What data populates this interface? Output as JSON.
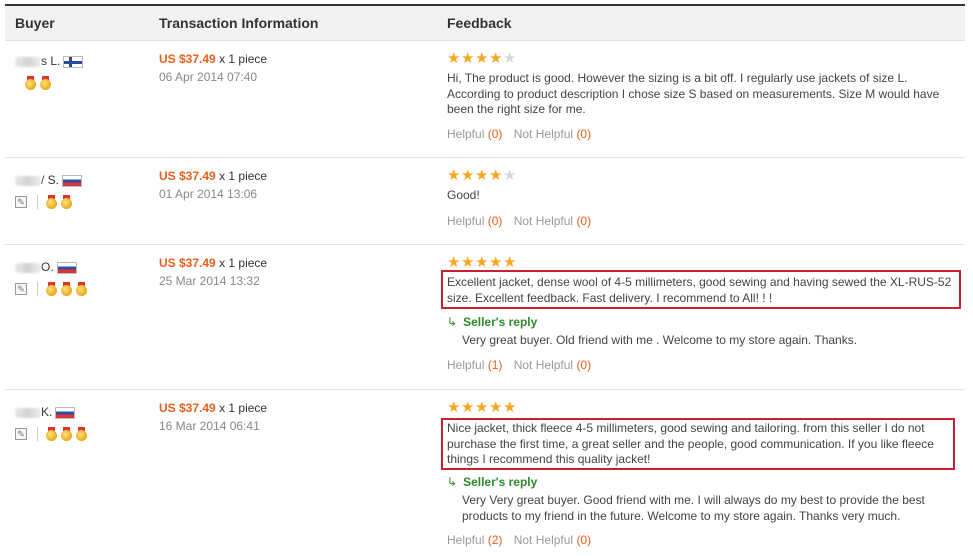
{
  "columns": {
    "buyer": "Buyer",
    "transaction": "Transaction Information",
    "feedback": "Feedback"
  },
  "reviews": [
    {
      "buyer_suffix": "s L.",
      "flag": "finland",
      "price": "US $37.49",
      "qty": "x 1 piece",
      "date": "06 Apr 2014 07:40",
      "rating": 4,
      "text": "Hi, The product is good. However the sizing is a bit off. I regularly use jackets of size L. According to product description I chose size S based on measurements. Size M would have been the right size for me.",
      "helpful_label": "Helpful",
      "helpful_count": "(0)",
      "not_helpful_label": "Not Helpful",
      "not_helpful_count": "(0)"
    },
    {
      "buyer_suffix": "/ S.",
      "flag": "russia",
      "price": "US $37.49",
      "qty": "x 1 piece",
      "date": "01 Apr 2014 13:06",
      "rating": 4,
      "text": "Good!",
      "helpful_label": "Helpful",
      "helpful_count": "(0)",
      "not_helpful_label": "Not Helpful",
      "not_helpful_count": "(0)"
    },
    {
      "buyer_suffix": "O.",
      "flag": "russia",
      "price": "US $37.49",
      "qty": "x 1 piece",
      "date": "25 Mar 2014 13:32",
      "rating": 5,
      "text": "Excellent jacket, dense wool of 4-5 millimeters, good sewing and having sewed the XL-RUS-52 size. Excellent feedback. Fast delivery. I recommend to All! ! !",
      "reply_label": "Seller's reply",
      "reply_text": "Very great buyer. Old friend with me . Welcome to my store again. Thanks.",
      "helpful_label": "Helpful",
      "helpful_count": "(1)",
      "not_helpful_label": "Not Helpful",
      "not_helpful_count": "(0)"
    },
    {
      "buyer_suffix": "K.",
      "flag": "russia",
      "price": "US $37.49",
      "qty": "x 1 piece",
      "date": "16 Mar 2014 06:41",
      "rating": 5,
      "text": "Nice jacket, thick fleece 4-5 millimeters, good sewing and tailoring. from this seller I do not purchase the first time, a great seller and the people, good communication. If you like fleece things I recommend this quality jacket!",
      "reply_label": "Seller's reply",
      "reply_text": "Very Very great buyer. Good friend with me. I will always do my best to provide the best products to my friend in the future. Welcome to my store again. Thanks very much.",
      "helpful_label": "Helpful",
      "helpful_count": "(2)",
      "not_helpful_label": "Not Helpful",
      "not_helpful_count": "(0)"
    }
  ],
  "colors": {
    "price": "#e5601c",
    "star": "#f5a623",
    "highlight_box": "#c8202e",
    "reply": "#2e8b2e"
  }
}
